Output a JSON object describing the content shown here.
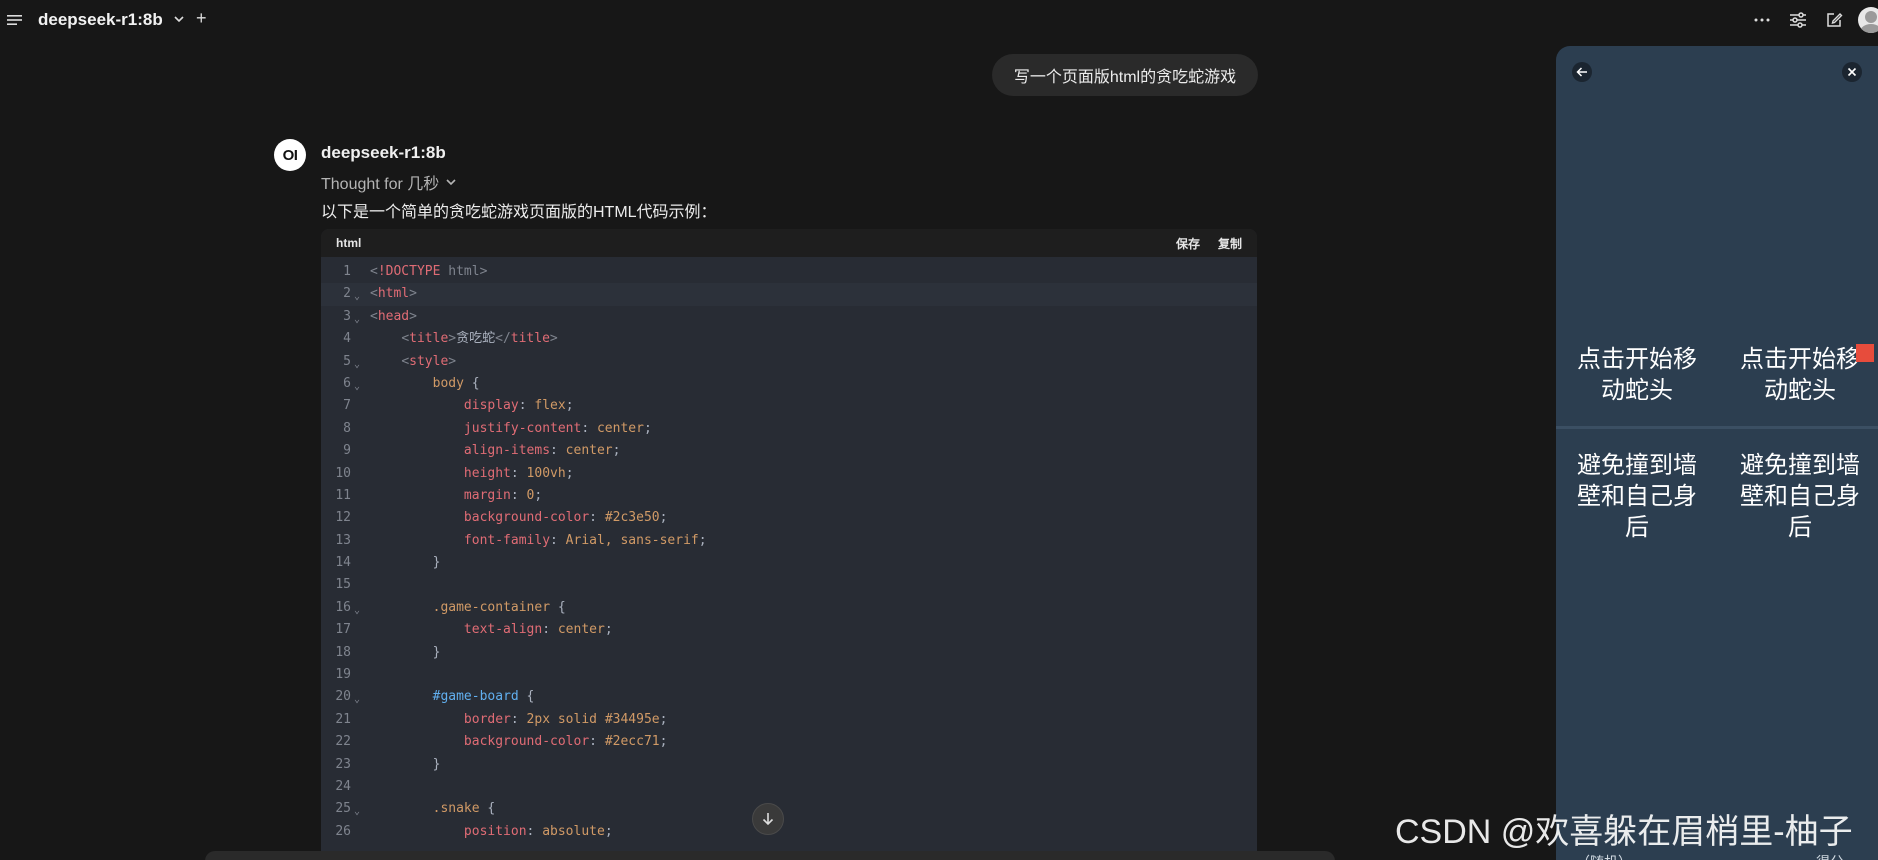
{
  "topbar": {
    "model_name": "deepseek-r1:8b",
    "icons": [
      "menu-icon",
      "chevron-down-icon",
      "plus-icon",
      "more-icon",
      "sliders-icon",
      "edit-icon",
      "avatar"
    ]
  },
  "user_message": "写一个页面版html的贪吃蛇游戏",
  "assistant": {
    "avatar_text": "OI",
    "name": "deepseek-r1:8b",
    "thought": "Thought for 几秒",
    "intro": "以下是一个简单的贪吃蛇游戏页面版的HTML代码示例："
  },
  "code": {
    "language": "html",
    "save_label": "保存",
    "copy_label": "复制",
    "line_numbers": [
      "1",
      "2",
      "3",
      "4",
      "5",
      "6",
      "7",
      "8",
      "9",
      "10",
      "11",
      "12",
      "13",
      "14",
      "15",
      "16",
      "17",
      "18",
      "19",
      "20",
      "21",
      "22",
      "23",
      "24",
      "25",
      "26"
    ],
    "lines": [
      "<!DOCTYPE html>",
      "<html>",
      "<head>",
      "    <title>贪吃蛇</title>",
      "    <style>",
      "        body {",
      "            display: flex;",
      "            justify-content: center;",
      "            align-items: center;",
      "            height: 100vh;",
      "            margin: 0;",
      "            background-color: #2c3e50;",
      "            font-family: Arial, sans-serif;",
      "        }",
      "",
      "        .game-container {",
      "            text-align: center;",
      "        }",
      "",
      "        #game-board {",
      "            border: 2px solid #34495e;",
      "            background-color: #2ecc71;",
      "        }",
      "",
      "        .snake {",
      "            position: absolute;"
    ]
  },
  "preview": {
    "cells": [
      "点击开始移动蛇头",
      "点击开始移动蛇头",
      "避免撞到墙壁和自己身后",
      "避免撞到墙壁和自己身后"
    ],
    "bottom_left": "（随机）",
    "bottom_right": "得分"
  },
  "watermark": "CSDN @欢喜躲在眉梢里-柚子",
  "colors": {
    "background": "#171717",
    "code_bg": "#282c34",
    "preview_bg": "#2c3e50",
    "snake_food": "#e74c3c"
  }
}
